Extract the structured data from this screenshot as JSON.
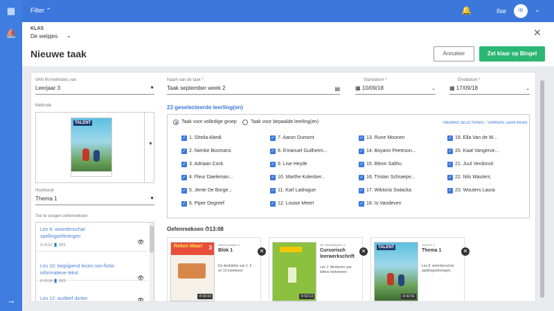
{
  "topbar": {
    "filter_label": "Filter",
    "user_name": "Ilse",
    "avatar_initials": "IB"
  },
  "header": {
    "klas_label": "KLAS",
    "klas_value": "De welpjes",
    "page_title": "Nieuwe taak",
    "cancel_label": "Annuleer",
    "primary_label": "Zet klaar op Bingel"
  },
  "form": {
    "van_label": "VAN IN-methodes van",
    "van_value": "Leerjaar 3",
    "methode_label": "Methode",
    "hoofdstuk_label": "Hoofdstuk",
    "hoofdstuk_value": "Thema 1",
    "toevoegen_label": "Toe te voegen oefenreeksen",
    "naam_label": "Naam van de taak *",
    "naam_value": "Taak september week 2",
    "start_label": "Startdatum *",
    "start_value": "10/09/18",
    "eind_label": "Einddatum *",
    "eind_value": "17/09/18"
  },
  "book_cover": {
    "title": "TALENT",
    "brand": "van in"
  },
  "available_exercises": [
    {
      "title_line1": "Les 6: woordenschat",
      "title_line2": "spellingoefeningen",
      "duration": "01:51",
      "count": "0/23"
    },
    {
      "title_line1": "Les 10: begrijpend lezen non-fictie:",
      "title_line2": "informatieve tekst",
      "duration": "05:54",
      "count": "0/23"
    },
    {
      "title_line1": "Les 12: auditief dictee",
      "title_line2": "",
      "duration": "",
      "count": ""
    }
  ],
  "students": {
    "selected_text": "23 geselecteerde leerling(en)",
    "option_full": "Taak voor volledige groep",
    "option_specific": "Taak voor bepaalde leerling(en)",
    "link_none": "NIEMAND SELECTEREN",
    "link_hide": "VERBERG LEERLINGEN",
    "columns": [
      [
        "1. Sheila Abedi",
        "2. Nienke Bosmans",
        "3. Adriaan Cock",
        "4. Fleur Daeleman...",
        "5. Jente De Borge...",
        "6. Piper Degreef"
      ],
      [
        "7. Aaron Dumont",
        "8. Emanuel Guilherm...",
        "9. Lise Heyde",
        "10. Marthe Kolenber...",
        "11. Karl Ladrague",
        "12. Louise Meert"
      ],
      [
        "13. Rune Moonen",
        "14. Boyann Peetroon...",
        "15. Bleon Salihu",
        "16. Tristan Schraepe...",
        "17. Wiktoria Swiacka",
        "18. Io Vandeven"
      ],
      [
        "19. Ella Van de W...",
        "20. Kaat Vangerve...",
        "21. Juul Verdonck",
        "22. Nils Wauters",
        "23. Wouters Laura"
      ]
    ]
  },
  "oefenreeksen": {
    "title": "Oefenreeksen",
    "total_time": "13:08",
    "cards": [
      {
        "cover": "Reken Maar!",
        "cover_number": "3",
        "subtitle": "REKEN MAAR! 3",
        "title_line1": "Blok 1",
        "title_line2": "",
        "desc": [
          "De deeltafels van 1, 5",
          "en 10 inoefenen"
        ],
        "duration": "03:10"
      },
      {
        "cover": "",
        "cover_number": "",
        "subtitle": "OP VERKENNING 3",
        "title_line1": "Cursorisch",
        "title_line2": "leerwerkschrift",
        "desc": [
          "Les 1: Merkeren van",
          "letters herkennen"
        ],
        "duration": "02:13"
      },
      {
        "cover": "TALENT",
        "cover_number": "",
        "subtitle": "TALENT 3",
        "title_line1": "Thema 1",
        "title_line2": "",
        "desc": [
          "Les 6: woordenschat",
          "spellingoefeningen"
        ],
        "duration": "01:51"
      }
    ]
  },
  "colors": {
    "primary": "#3c78dc",
    "rail": "#3f7ee0",
    "success": "#2bb673"
  }
}
